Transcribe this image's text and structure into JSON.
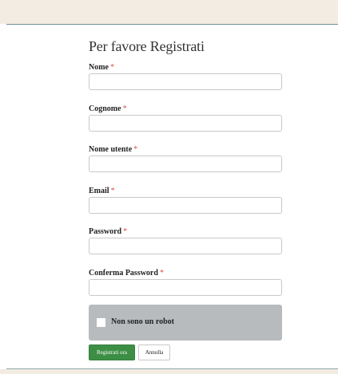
{
  "form": {
    "title": "Per favore Registrati",
    "required_marker": "*",
    "fields": [
      {
        "label": "Nome",
        "value": ""
      },
      {
        "label": "Cognome",
        "value": ""
      },
      {
        "label": "Nome utente",
        "value": ""
      },
      {
        "label": "Email",
        "value": ""
      },
      {
        "label": "Password",
        "value": ""
      },
      {
        "label": "Conferma Password",
        "value": ""
      }
    ],
    "captcha_label": "Non sono un robot",
    "submit_label": "Registrati ora",
    "cancel_label": "Annulla"
  },
  "colors": {
    "header_band": "#f3ece2",
    "rule": "#6f8f97",
    "submit_bg": "#3d8e45",
    "required": "#d9534f",
    "captcha_bg": "#b7bbbd"
  }
}
